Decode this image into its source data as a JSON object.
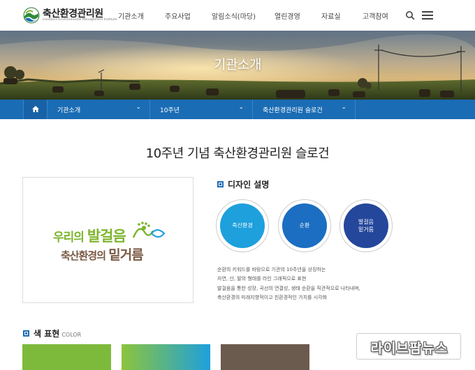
{
  "header": {
    "logo_ko": "축산환경관리원",
    "logo_en": "Livestock Environmental Management Institute",
    "nav": [
      "기관소개",
      "주요사업",
      "알림소식(마당)",
      "열린경영",
      "자료실",
      "고객참여"
    ]
  },
  "hero": {
    "title": "기관소개"
  },
  "location": {
    "items": [
      "기관소개",
      "10주년",
      "축산환경관리원 슬로건"
    ],
    "chevron": "⌄"
  },
  "page": {
    "title": "10주년 기념 축산환경관리원 슬로건"
  },
  "slogan": {
    "line1_a": "우리의 ",
    "line1_b": "발걸음",
    "line2_a": "축산환경의 ",
    "line2_b": "밑거름"
  },
  "design": {
    "heading": "디자인 설명",
    "circles": [
      {
        "label": "축산환경",
        "color": "#1ea0dc"
      },
      {
        "label": "순환",
        "color": "#1b6ec1"
      },
      {
        "label": "발걸음\n밑거름",
        "color": "#24479b"
      }
    ],
    "description": [
      "순환의 키워드를 바탕으로 기관의 10주년을 상징하는",
      "자연, 산, 발의 형태를 라인 그래픽으로 표현",
      "발걸음을 통한 성장, 곡선의 연결성, 생태 순환을 직관적으로 나타내며,",
      "축산환경의 미래지향적이고 친환경적인 가치를 시각화"
    ]
  },
  "color_section": {
    "heading": "색 표현",
    "sub": "COLOR",
    "swatches": [
      "#7dba3c",
      "gradient-green-blue",
      "#6b5a4e"
    ]
  },
  "watermark": {
    "text": "라이브팜뉴스"
  },
  "colors": {
    "primary": "#1a6cb5",
    "green": "#7db52d",
    "brown": "#7a5a44"
  }
}
